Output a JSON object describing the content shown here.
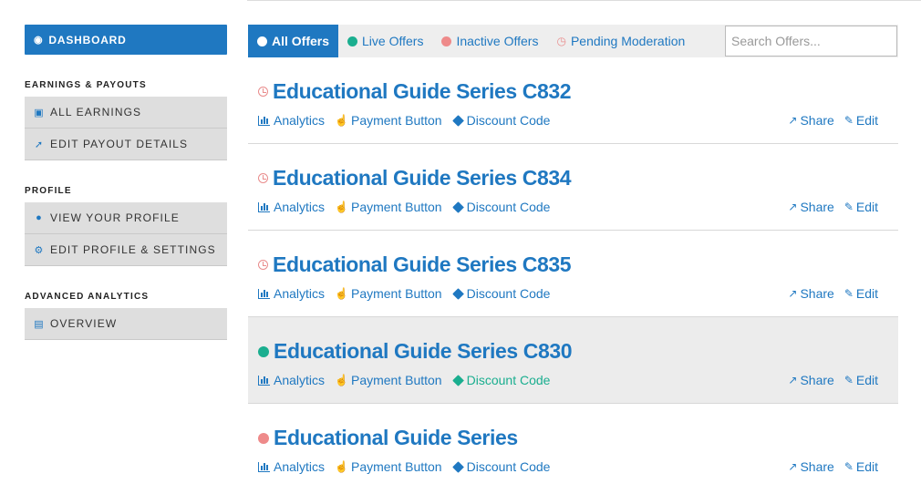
{
  "sidebar": {
    "dashboard_label": "DASHBOARD",
    "sections": [
      {
        "heading": "EARNINGS & PAYOUTS",
        "items": [
          {
            "label": "ALL EARNINGS",
            "icon": "money-icon"
          },
          {
            "label": "EDIT PAYOUT DETAILS",
            "icon": "wrench-icon"
          }
        ]
      },
      {
        "heading": "PROFILE",
        "items": [
          {
            "label": "VIEW YOUR PROFILE",
            "icon": "user-icon"
          },
          {
            "label": "EDIT PROFILE & SETTINGS",
            "icon": "cogs-icon"
          }
        ]
      },
      {
        "heading": "ADVANCED ANALYTICS",
        "items": [
          {
            "label": "OVERVIEW",
            "icon": "bar-chart-icon"
          }
        ]
      }
    ]
  },
  "tabs": {
    "all": "All Offers",
    "live": "Live Offers",
    "inactive": "Inactive Offers",
    "pending": "Pending Moderation",
    "search_placeholder": "Search Offers..."
  },
  "offer_links": {
    "analytics": "Analytics",
    "payment": "Payment Button",
    "discount": "Discount Code",
    "share": "Share",
    "edit": "Edit"
  },
  "offers": [
    {
      "title": "Educational Guide Series C832",
      "status": "pending"
    },
    {
      "title": "Educational Guide Series C834",
      "status": "pending"
    },
    {
      "title": "Educational Guide Series C835",
      "status": "pending"
    },
    {
      "title": "Educational Guide Series C830",
      "status": "live"
    },
    {
      "title": "Educational Guide Series",
      "status": "inactive"
    }
  ],
  "colors": {
    "accent": "#1f78c1",
    "live": "#1aae8f",
    "inactive": "#ee8a8a",
    "pending": "#e98c8c",
    "sidebar_item_bg": "#dedede"
  }
}
